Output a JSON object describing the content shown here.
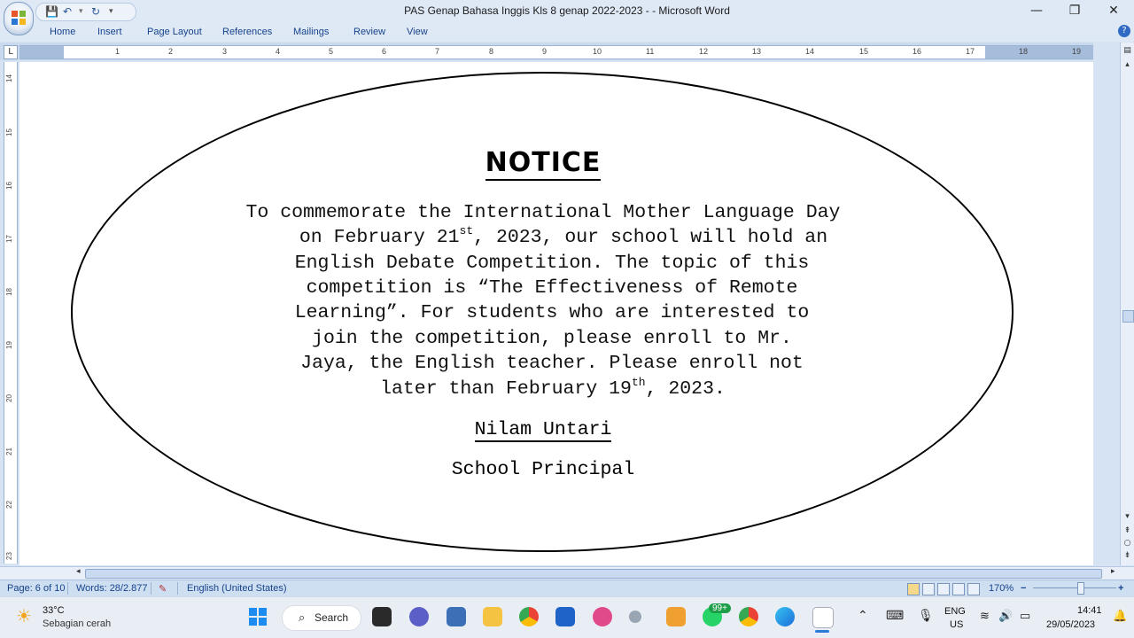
{
  "window": {
    "title": "PAS Genap Bahasa Inggis Kls 8 genap 2022-2023 - - Microsoft Word",
    "minimize": "—",
    "restore": "❐",
    "close": "✕"
  },
  "ribbon": {
    "tabs": [
      "Home",
      "Insert",
      "Page Layout",
      "References",
      "Mailings",
      "Review",
      "View"
    ],
    "help": "?"
  },
  "ruler": {
    "numbers": [
      "1",
      "2",
      "3",
      "4",
      "5",
      "6",
      "7",
      "8",
      "9",
      "10",
      "11",
      "12",
      "13",
      "14",
      "15",
      "16",
      "17",
      "18",
      "19"
    ],
    "vertical_numbers": [
      "14",
      "15",
      "16",
      "17",
      "18",
      "19",
      "20",
      "21",
      "22",
      "23"
    ]
  },
  "document": {
    "title": "NOTICE",
    "lines": [
      "To commemorate the International Mother Language Day",
      "on February 21",
      "English Debate Competition. The topic of this",
      "competition is “The Effectiveness of Remote",
      "Learning”. For students who are interested to",
      "join the competition, please enroll to Mr.",
      "Jaya, the English teacher. Please enroll not",
      "later than February 19"
    ],
    "line2_sup": "st",
    "line2_rest": ", 2023, our school will hold an",
    "line8_sup": "th",
    "line8_rest": ", 2023.",
    "signature_name": "Nilam Untari",
    "signature_title": "School Principal"
  },
  "status": {
    "page": "Page: 6 of 10",
    "words": "Words: 28/2.877",
    "language": "English (United States)",
    "zoom": "170%",
    "zoom_minus": "−",
    "zoom_plus": "+"
  },
  "taskbar": {
    "weather_temp": "33°C",
    "weather_desc": "Sebagian cerah",
    "search_label": "Search",
    "badge": "99+",
    "lang_top": "ENG",
    "lang_bottom": "US",
    "time": "14:41",
    "date": "29/05/2023"
  },
  "colors": {
    "accent": "#15428b",
    "ribbon_bg": "#dfe9f5",
    "status_bg": "#cfdff2"
  }
}
